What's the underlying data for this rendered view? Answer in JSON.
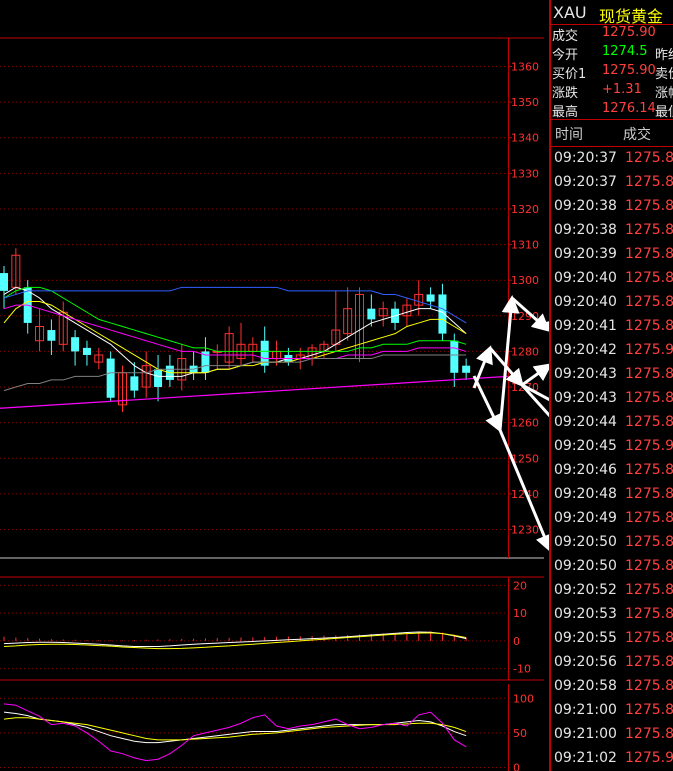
{
  "chart_data": [
    {
      "type": "candlestick",
      "ylim": [
        1222,
        1368
      ],
      "yticks": [
        1360,
        1350,
        1340,
        1330,
        1320,
        1310,
        1300,
        1290,
        1280,
        1270,
        1260,
        1250,
        1240,
        1230
      ],
      "candles": [
        {
          "o": 1302,
          "c": 1297,
          "h": 1304,
          "l": 1292
        },
        {
          "o": 1298,
          "c": 1307,
          "h": 1309,
          "l": 1296
        },
        {
          "o": 1298,
          "c": 1288,
          "h": 1300,
          "l": 1285
        },
        {
          "o": 1283,
          "c": 1287,
          "h": 1292,
          "l": 1280
        },
        {
          "o": 1286,
          "c": 1283,
          "h": 1289,
          "l": 1279
        },
        {
          "o": 1282,
          "c": 1291,
          "h": 1294,
          "l": 1280
        },
        {
          "o": 1284,
          "c": 1280,
          "h": 1286,
          "l": 1276
        },
        {
          "o": 1281,
          "c": 1279,
          "h": 1283,
          "l": 1276
        },
        {
          "o": 1277,
          "c": 1279,
          "h": 1281,
          "l": 1275
        },
        {
          "o": 1278,
          "c": 1267,
          "h": 1280,
          "l": 1266
        },
        {
          "o": 1265,
          "c": 1274,
          "h": 1276,
          "l": 1263
        },
        {
          "o": 1273,
          "c": 1269,
          "h": 1277,
          "l": 1267
        },
        {
          "o": 1270,
          "c": 1276,
          "h": 1280,
          "l": 1267
        },
        {
          "o": 1275,
          "c": 1270,
          "h": 1279,
          "l": 1266
        },
        {
          "o": 1276,
          "c": 1272,
          "h": 1279,
          "l": 1270
        },
        {
          "o": 1272,
          "c": 1278,
          "h": 1282,
          "l": 1269
        },
        {
          "o": 1276,
          "c": 1274,
          "h": 1280,
          "l": 1272
        },
        {
          "o": 1280,
          "c": 1274,
          "h": 1284,
          "l": 1272
        },
        {
          "o": 1280,
          "c": 1280,
          "h": 1282,
          "l": 1275
        },
        {
          "o": 1277,
          "c": 1285,
          "h": 1287,
          "l": 1275
        },
        {
          "o": 1278,
          "c": 1282,
          "h": 1288,
          "l": 1276
        },
        {
          "o": 1280,
          "c": 1282,
          "h": 1284,
          "l": 1277
        },
        {
          "o": 1283,
          "c": 1276,
          "h": 1287,
          "l": 1274
        },
        {
          "o": 1278,
          "c": 1280,
          "h": 1283,
          "l": 1276
        },
        {
          "o": 1279,
          "c": 1277,
          "h": 1281,
          "l": 1276
        },
        {
          "o": 1278,
          "c": 1279,
          "h": 1281,
          "l": 1275
        },
        {
          "o": 1278,
          "c": 1281,
          "h": 1282,
          "l": 1276
        },
        {
          "o": 1280,
          "c": 1282,
          "h": 1283,
          "l": 1278
        },
        {
          "o": 1282,
          "c": 1286,
          "h": 1297,
          "l": 1280
        },
        {
          "o": 1285,
          "c": 1292,
          "h": 1298,
          "l": 1283
        },
        {
          "o": 1278,
          "c": 1296,
          "h": 1298,
          "l": 1277
        },
        {
          "o": 1292,
          "c": 1289,
          "h": 1296,
          "l": 1287
        },
        {
          "o": 1290,
          "c": 1292,
          "h": 1294,
          "l": 1287
        },
        {
          "o": 1292,
          "c": 1288,
          "h": 1294,
          "l": 1286
        },
        {
          "o": 1290,
          "c": 1293,
          "h": 1295,
          "l": 1287
        },
        {
          "o": 1293,
          "c": 1296,
          "h": 1300,
          "l": 1290
        },
        {
          "o": 1296,
          "c": 1294,
          "h": 1298,
          "l": 1292
        },
        {
          "o": 1296,
          "c": 1285,
          "h": 1299,
          "l": 1283
        },
        {
          "o": 1283,
          "c": 1274,
          "h": 1285,
          "l": 1270
        },
        {
          "o": 1276,
          "c": 1274,
          "h": 1278,
          "l": 1272
        }
      ],
      "ma": [
        {
          "color": "#ffffff",
          "values": [
            1296,
            1298,
            1297,
            1295,
            1292,
            1290,
            1288,
            1286,
            1284,
            1282,
            1279,
            1276,
            1274,
            1273,
            1273,
            1273,
            1274,
            1274,
            1275,
            1275,
            1276,
            1277,
            1277,
            1277,
            1278,
            1278,
            1279,
            1280,
            1282,
            1284,
            1286,
            1288,
            1289,
            1290,
            1291,
            1292,
            1292,
            1291,
            1288,
            1285
          ]
        },
        {
          "color": "#ffff00",
          "values": [
            1288,
            1292,
            1294,
            1294,
            1293,
            1291,
            1289,
            1287,
            1285,
            1283,
            1281,
            1279,
            1277,
            1275,
            1274,
            1274,
            1274,
            1274,
            1275,
            1275,
            1276,
            1276,
            1277,
            1277,
            1277,
            1278,
            1278,
            1279,
            1280,
            1281,
            1282,
            1283,
            1284,
            1285,
            1287,
            1288,
            1289,
            1289,
            1287,
            1285
          ]
        },
        {
          "color": "#ff00ff",
          "values": [
            1292,
            1293,
            1293,
            1292,
            1291,
            1290,
            1289,
            1288,
            1287,
            1286,
            1285,
            1284,
            1283,
            1282,
            1281,
            1280,
            1280,
            1279,
            1279,
            1279,
            1279,
            1279,
            1278,
            1278,
            1278,
            1278,
            1278,
            1278,
            1278,
            1279,
            1279,
            1279,
            1280,
            1280,
            1280,
            1281,
            1281,
            1281,
            1281,
            1280
          ]
        },
        {
          "color": "#00ff00",
          "values": [
            1295,
            1297,
            1298,
            1298,
            1297,
            1295,
            1293,
            1291,
            1289,
            1288,
            1287,
            1286,
            1285,
            1284,
            1283,
            1282,
            1281,
            1281,
            1280,
            1280,
            1280,
            1280,
            1280,
            1280,
            1280,
            1280,
            1280,
            1280,
            1280,
            1280,
            1281,
            1281,
            1282,
            1282,
            1282,
            1283,
            1283,
            1283,
            1283,
            1282
          ]
        },
        {
          "color": "#3060ff",
          "values": [
            1295,
            1296,
            1297,
            1297,
            1297,
            1297,
            1297,
            1297,
            1297,
            1297,
            1297,
            1297,
            1297,
            1297,
            1297,
            1298,
            1298,
            1298,
            1298,
            1298,
            1298,
            1298,
            1298,
            1298,
            1297,
            1297,
            1297,
            1297,
            1297,
            1297,
            1297,
            1297,
            1296,
            1296,
            1295,
            1294,
            1293,
            1292,
            1290,
            1288
          ]
        },
        {
          "color": "#808080",
          "values": [
            1269,
            1270,
            1271,
            1271,
            1272,
            1272,
            1273,
            1273,
            1273,
            1274,
            1274,
            1274,
            1274,
            1275,
            1275,
            1275,
            1275,
            1276,
            1276,
            1276,
            1276,
            1277,
            1277,
            1277,
            1277,
            1277,
            1278,
            1278,
            1278,
            1278,
            1278,
            1278,
            1279,
            1279,
            1279,
            1279,
            1279,
            1279,
            1279,
            1279
          ]
        }
      ],
      "trendline": {
        "color": "#ff00ff",
        "from": [
          1,
          1264
        ],
        "to": [
          40,
          1273
        ]
      }
    },
    {
      "type": "bar",
      "ylim": [
        -13,
        23
      ],
      "yticks": [
        20,
        10,
        0,
        -10
      ],
      "values": [
        1.5,
        1.2,
        1,
        0.8,
        0.6,
        0.5,
        0.4,
        0.3,
        0.3,
        0.2,
        0.2,
        0.3,
        0.4,
        0.5,
        0.6,
        0.7,
        0.8,
        0.9,
        1,
        1.1,
        1.2,
        1.3,
        1.4,
        1.5,
        1.6,
        1.7,
        1.8,
        1.9,
        2,
        2.1,
        2.3,
        2.5,
        2.7,
        2.9,
        3.1,
        3.3,
        3.4,
        3.0,
        2.2,
        1.2
      ],
      "lines": [
        {
          "color": "#ffffff",
          "values": [
            -1,
            -0.8,
            -0.6,
            -0.5,
            -0.5,
            -0.6,
            -0.8,
            -1,
            -1.2,
            -1.5,
            -1.8,
            -2,
            -2,
            -2,
            -1.8,
            -1.5,
            -1.2,
            -1,
            -0.8,
            -0.6,
            -0.4,
            -0.2,
            0,
            0.2,
            0.4,
            0.6,
            0.8,
            1,
            1.2,
            1.5,
            1.8,
            2.1,
            2.4,
            2.7,
            3,
            3.2,
            3.1,
            2.6,
            1.8,
            0.8
          ]
        },
        {
          "color": "#ffff00",
          "values": [
            -2,
            -1.8,
            -1.5,
            -1.3,
            -1.2,
            -1.2,
            -1.3,
            -1.5,
            -1.7,
            -1.9,
            -2.2,
            -2.4,
            -2.6,
            -2.8,
            -2.8,
            -2.7,
            -2.5,
            -2.3,
            -2,
            -1.8,
            -1.5,
            -1.2,
            -0.9,
            -0.6,
            -0.3,
            0,
            0.3,
            0.6,
            0.9,
            1.2,
            1.5,
            1.8,
            2.1,
            2.4,
            2.6,
            2.8,
            2.9,
            2.6,
            2,
            1.2
          ]
        }
      ]
    },
    {
      "type": "line",
      "ylim": [
        -5,
        112
      ],
      "yticks": [
        100,
        50,
        0
      ],
      "series": [
        {
          "color": "#ffffff",
          "values": [
            80,
            78,
            75,
            70,
            68,
            66,
            62,
            58,
            52,
            46,
            42,
            38,
            36,
            36,
            38,
            40,
            42,
            44,
            46,
            48,
            50,
            52,
            52,
            52,
            54,
            56,
            58,
            60,
            62,
            62,
            62,
            62,
            62,
            64,
            66,
            68,
            66,
            60,
            52,
            46
          ]
        },
        {
          "color": "#ffff00",
          "values": [
            70,
            72,
            72,
            70,
            68,
            66,
            64,
            62,
            58,
            54,
            50,
            46,
            42,
            40,
            40,
            40,
            41,
            42,
            43,
            44,
            46,
            48,
            49,
            50,
            52,
            54,
            56,
            58,
            59,
            60,
            61,
            62,
            62,
            62,
            63,
            64,
            64,
            62,
            58,
            52
          ]
        },
        {
          "color": "#ff00ff",
          "values": [
            92,
            90,
            82,
            74,
            62,
            64,
            60,
            50,
            38,
            24,
            20,
            14,
            10,
            12,
            20,
            32,
            46,
            50,
            54,
            58,
            64,
            72,
            76,
            60,
            56,
            60,
            62,
            66,
            70,
            62,
            56,
            58,
            62,
            64,
            60,
            76,
            80,
            64,
            40,
            30
          ]
        }
      ]
    }
  ],
  "quote": {
    "symbol": "XAU",
    "name": "现货黄金",
    "rows": [
      {
        "k": "成交",
        "v": "1275.90",
        "k2": ""
      },
      {
        "k": "今开",
        "v": "1274.5",
        "k2": "昨结"
      },
      {
        "k": "买价1",
        "v": "1275.90",
        "k2": "卖价"
      },
      {
        "k": "涨跌",
        "v": "+1.31",
        "k2": "涨幅"
      },
      {
        "k": "最高",
        "v": "1276.14",
        "k2": "最低"
      }
    ]
  },
  "ticks": {
    "header_time": "时间",
    "header_price": "成交",
    "rows": [
      {
        "t": "09:20:37",
        "p": "1275.8"
      },
      {
        "t": "09:20:37",
        "p": "1275.8"
      },
      {
        "t": "09:20:38",
        "p": "1275.8"
      },
      {
        "t": "09:20:38",
        "p": "1275.8"
      },
      {
        "t": "09:20:39",
        "p": "1275.8"
      },
      {
        "t": "09:20:40",
        "p": "1275.8"
      },
      {
        "t": "09:20:40",
        "p": "1275.8"
      },
      {
        "t": "09:20:41",
        "p": "1275.8"
      },
      {
        "t": "09:20:42",
        "p": "1275.9"
      },
      {
        "t": "09:20:43",
        "p": "1275.8"
      },
      {
        "t": "09:20:43",
        "p": "1275.8"
      },
      {
        "t": "09:20:44",
        "p": "1275.8"
      },
      {
        "t": "09:20:45",
        "p": "1275.9"
      },
      {
        "t": "09:20:46",
        "p": "1275.8"
      },
      {
        "t": "09:20:48",
        "p": "1275.8"
      },
      {
        "t": "09:20:49",
        "p": "1275.8"
      },
      {
        "t": "09:20:50",
        "p": "1275.8"
      },
      {
        "t": "09:20:50",
        "p": "1275.8"
      },
      {
        "t": "09:20:52",
        "p": "1275.8"
      },
      {
        "t": "09:20:53",
        "p": "1275.8"
      },
      {
        "t": "09:20:55",
        "p": "1275.8"
      },
      {
        "t": "09:20:56",
        "p": "1275.8"
      },
      {
        "t": "09:20:58",
        "p": "1275.8"
      },
      {
        "t": "09:21:00",
        "p": "1275.8"
      },
      {
        "t": "09:21:00",
        "p": "1275.8"
      },
      {
        "t": "09:21:02",
        "p": "1275.9"
      }
    ]
  },
  "colors": {
    "up": "#ff3030",
    "down": "#54ffff",
    "grid": "#8b0000",
    "axis": "#c00000"
  }
}
